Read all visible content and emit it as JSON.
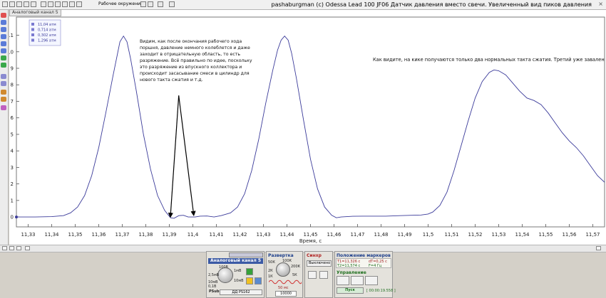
{
  "window": {
    "title": "pashaburgman (c) Odessa  Lead 100 JF06 Датчик давления вместо свечи. Увеличенный вид пиков давления",
    "close_glyph": "×"
  },
  "toolbar": {
    "workspace_label": "Рабочее окружение"
  },
  "plot_tab": {
    "label": "Аналоговый канал 5"
  },
  "markers_legend": {
    "rows": [
      "11,04 атм",
      "0,714 атм",
      "0,302 атм",
      "1,296 атм"
    ]
  },
  "annotations": {
    "left_note": "Видим, как после окончания рабочего хода поршня, давление немного колеблется и даже заходит в отрицательную область, то есть разряжение. Всё правильно по идее, поскольку это разряжение из впускного коллектора и происходит засасывание смеси в цилиндр для нового такта сжатия и т.д.",
    "right_note": "Как видите, на кике получаются только два нормальных такта сжатия. Третий уже завален"
  },
  "chart_data": {
    "type": "line",
    "title": "",
    "xlabel": "Время, с",
    "ylabel": "",
    "xlim": [
      11.325,
      11.575
    ],
    "ylim": [
      -0.6,
      12.1
    ],
    "x_ticks": [
      11.33,
      11.34,
      11.35,
      11.36,
      11.37,
      11.38,
      11.39,
      11.4,
      11.41,
      11.42,
      11.43,
      11.44,
      11.45,
      11.46,
      11.47,
      11.48,
      11.49,
      11.5,
      11.51,
      11.52,
      11.53,
      11.54,
      11.55,
      11.56,
      11.57
    ],
    "x_tick_labels": [
      "11,33",
      "11,34",
      "11,35",
      "11,36",
      "11,37",
      "11,38",
      "11,39",
      "11,4",
      "11,41",
      "11,42",
      "11,43",
      "11,44",
      "11,45",
      "11,46",
      "11,47",
      "11,48",
      "11,49",
      "11,5",
      "11,51",
      "11,52",
      "11,53",
      "11,54",
      "11,55",
      "11,56",
      "11,57"
    ],
    "y_ticks": [
      0,
      1,
      2,
      3,
      4,
      5,
      6,
      7,
      8,
      9,
      10,
      11
    ],
    "y_tick_labels": [
      "0",
      "1",
      "2",
      "3",
      "4",
      "5",
      "6",
      "7",
      "8",
      "9",
      "10",
      "11"
    ],
    "grid": false,
    "series": [
      {
        "color": "#3b3b9a",
        "points": [
          [
            11.325,
            0.0
          ],
          [
            11.333,
            0.0
          ],
          [
            11.34,
            0.02
          ],
          [
            11.345,
            0.08
          ],
          [
            11.348,
            0.25
          ],
          [
            11.351,
            0.6
          ],
          [
            11.354,
            1.3
          ],
          [
            11.357,
            2.5
          ],
          [
            11.36,
            4.2
          ],
          [
            11.363,
            6.3
          ],
          [
            11.366,
            8.5
          ],
          [
            11.368,
            9.9
          ],
          [
            11.369,
            10.6
          ],
          [
            11.3705,
            10.95
          ],
          [
            11.372,
            10.6
          ],
          [
            11.3735,
            9.6
          ],
          [
            11.376,
            7.6
          ],
          [
            11.379,
            5.0
          ],
          [
            11.382,
            2.9
          ],
          [
            11.385,
            1.3
          ],
          [
            11.388,
            0.4
          ],
          [
            11.3905,
            -0.05
          ],
          [
            11.392,
            -0.08
          ],
          [
            11.394,
            0.08
          ],
          [
            11.396,
            0.1
          ],
          [
            11.398,
            0.0
          ],
          [
            11.401,
            0.0
          ],
          [
            11.403,
            0.05
          ],
          [
            11.406,
            0.06
          ],
          [
            11.409,
            0.0
          ],
          [
            11.412,
            0.08
          ],
          [
            11.416,
            0.25
          ],
          [
            11.419,
            0.6
          ],
          [
            11.422,
            1.4
          ],
          [
            11.425,
            2.8
          ],
          [
            11.428,
            4.7
          ],
          [
            11.431,
            6.9
          ],
          [
            11.434,
            8.9
          ],
          [
            11.436,
            10.1
          ],
          [
            11.4375,
            10.7
          ],
          [
            11.439,
            10.95
          ],
          [
            11.4405,
            10.7
          ],
          [
            11.442,
            9.9
          ],
          [
            11.444,
            8.4
          ],
          [
            11.447,
            5.9
          ],
          [
            11.45,
            3.5
          ],
          [
            11.453,
            1.7
          ],
          [
            11.456,
            0.6
          ],
          [
            11.459,
            0.1
          ],
          [
            11.461,
            -0.05
          ],
          [
            11.463,
            0.0
          ],
          [
            11.468,
            0.04
          ],
          [
            11.475,
            0.05
          ],
          [
            11.482,
            0.05
          ],
          [
            11.488,
            0.08
          ],
          [
            11.493,
            0.1
          ],
          [
            11.497,
            0.12
          ],
          [
            11.5,
            0.18
          ],
          [
            11.502,
            0.3
          ],
          [
            11.505,
            0.7
          ],
          [
            11.508,
            1.5
          ],
          [
            11.511,
            2.8
          ],
          [
            11.514,
            4.3
          ],
          [
            11.517,
            5.8
          ],
          [
            11.52,
            7.2
          ],
          [
            11.523,
            8.2
          ],
          [
            11.526,
            8.75
          ],
          [
            11.528,
            8.9
          ],
          [
            11.53,
            8.85
          ],
          [
            11.533,
            8.6
          ],
          [
            11.536,
            8.1
          ],
          [
            11.539,
            7.6
          ],
          [
            11.542,
            7.2
          ],
          [
            11.545,
            7.05
          ],
          [
            11.548,
            6.8
          ],
          [
            11.551,
            6.3
          ],
          [
            11.554,
            5.7
          ],
          [
            11.557,
            5.1
          ],
          [
            11.56,
            4.6
          ],
          [
            11.563,
            4.2
          ],
          [
            11.566,
            3.7
          ],
          [
            11.569,
            3.1
          ],
          [
            11.572,
            2.5
          ],
          [
            11.575,
            2.1
          ]
        ]
      }
    ]
  },
  "bottom_panel": {
    "channel_title": "Аналоговый канал 5",
    "channel_ranges": [
      "100В",
      "2,5мВ",
      "1мВ",
      "10мВ",
      "10мВ",
      "0,1В"
    ],
    "channel_value": "ДД PS162",
    "psu_label": "PSub",
    "sweep_title": "Развертка",
    "sweep_ranges": [
      "50К",
      "100К",
      "200К",
      "2К",
      "1К",
      "5К"
    ],
    "sweep_time": "50 мс",
    "sweep_points": "10000",
    "sync_title": "Синхр",
    "sync_mode": "Выключено",
    "markers_title": "Положение маркеров",
    "t1": "T1=11,326 с",
    "dt": "dT=0,25 с",
    "t2": "T2=11,574 с",
    "freq": "F=4 Гц",
    "control_title": "Управление",
    "start_label": "Пуск",
    "elapsed": "[ 00:00:19.558 ]"
  }
}
